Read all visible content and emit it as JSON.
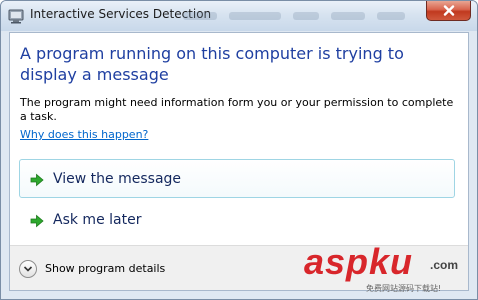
{
  "window": {
    "title": "Interactive Services Detection",
    "icon": "service-monitor-icon"
  },
  "dialog": {
    "heading": "A program running on this computer is trying to display a message",
    "description": "The program might need information form you or your permission to complete a task.",
    "help_link": "Why does this happen?",
    "commands": [
      {
        "label": "View the message",
        "icon": "green-arrow-icon"
      },
      {
        "label": "Ask me later",
        "icon": "green-arrow-icon"
      }
    ]
  },
  "footer": {
    "details_label": "Show program details",
    "details_icon": "chevron-down-icon"
  },
  "watermark": {
    "logo": "aspku",
    "tld": ".com",
    "subtitle": "免费网站源码下载站!"
  },
  "colors": {
    "heading": "#1f3fa1",
    "link": "#0066cc",
    "command_text": "#14285e",
    "arrow": "#2ea82e",
    "close_button": "#c0391f",
    "watermark": "#d8262b"
  }
}
